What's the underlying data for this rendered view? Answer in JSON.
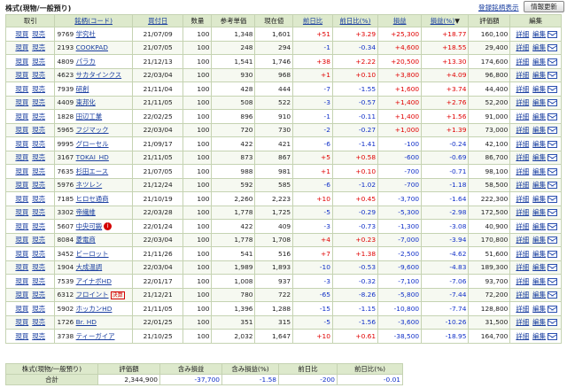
{
  "header": {
    "title": "株式(現物/一般預り)",
    "register_link": "登録銘柄表示",
    "refresh_button": "情報更新"
  },
  "columns": {
    "trade": "取引",
    "code": "銘柄(コード)",
    "buy_date": "買付日",
    "qty": "数量",
    "ref_price": "参考単価",
    "cur_price": "現在値",
    "day_change": "前日比",
    "day_change_pct": "前日比(%)",
    "pl": "損益",
    "pl_pct": "損益(%)",
    "sort_mark": "▼",
    "value": "評価額",
    "edit": "編集"
  },
  "actions": {
    "buy": "現買",
    "sell": "現売",
    "detail": "詳細",
    "edit": "編集"
  },
  "rows": [
    {
      "code": "9769",
      "name": "学究社",
      "date": "21/07/09",
      "qty": "100",
      "ref": "1,348",
      "cur": "1,601",
      "chg": "+51",
      "chgp": "+3.29",
      "pl": "+25,300",
      "plp": "+18.77",
      "val": "160,100"
    },
    {
      "code": "2193",
      "name": "COOKPAD",
      "date": "21/07/05",
      "qty": "100",
      "ref": "248",
      "cur": "294",
      "chg": "-1",
      "chgp": "-0.34",
      "pl": "+4,600",
      "plp": "+18.55",
      "val": "29,400"
    },
    {
      "code": "4809",
      "name": "パラカ",
      "date": "21/12/13",
      "qty": "100",
      "ref": "1,541",
      "cur": "1,746",
      "chg": "+38",
      "chgp": "+2.22",
      "pl": "+20,500",
      "plp": "+13.30",
      "val": "174,600"
    },
    {
      "code": "4623",
      "name": "サカタインクス",
      "date": "22/03/04",
      "qty": "100",
      "ref": "930",
      "cur": "968",
      "chg": "+1",
      "chgp": "+0.10",
      "pl": "+3,800",
      "plp": "+4.09",
      "val": "96,800"
    },
    {
      "code": "7939",
      "name": "研創",
      "date": "21/11/04",
      "qty": "100",
      "ref": "428",
      "cur": "444",
      "chg": "-7",
      "chgp": "-1.55",
      "pl": "+1,600",
      "plp": "+3.74",
      "val": "44,400"
    },
    {
      "code": "4409",
      "name": "東邦化",
      "date": "21/11/05",
      "qty": "100",
      "ref": "508",
      "cur": "522",
      "chg": "-3",
      "chgp": "-0.57",
      "pl": "+1,400",
      "plp": "+2.76",
      "val": "52,200"
    },
    {
      "code": "1828",
      "name": "田辺工業",
      "date": "22/02/25",
      "qty": "100",
      "ref": "896",
      "cur": "910",
      "chg": "-1",
      "chgp": "-0.11",
      "pl": "+1,400",
      "plp": "+1.56",
      "val": "91,000"
    },
    {
      "code": "5965",
      "name": "フジマック",
      "date": "22/03/04",
      "qty": "100",
      "ref": "720",
      "cur": "730",
      "chg": "-2",
      "chgp": "-0.27",
      "pl": "+1,000",
      "plp": "+1.39",
      "val": "73,000"
    },
    {
      "code": "9995",
      "name": "グローセル",
      "date": "21/09/17",
      "qty": "100",
      "ref": "422",
      "cur": "421",
      "chg": "-6",
      "chgp": "-1.41",
      "pl": "-100",
      "plp": "-0.24",
      "val": "42,100"
    },
    {
      "code": "3167",
      "name": "TOKAI_HD",
      "date": "21/11/05",
      "qty": "100",
      "ref": "873",
      "cur": "867",
      "chg": "+5",
      "chgp": "+0.58",
      "pl": "-600",
      "plp": "-0.69",
      "val": "86,700"
    },
    {
      "code": "7635",
      "name": "杉田エース",
      "date": "21/07/05",
      "qty": "100",
      "ref": "988",
      "cur": "981",
      "chg": "+1",
      "chgp": "+0.10",
      "pl": "-700",
      "plp": "-0.71",
      "val": "98,100"
    },
    {
      "code": "5976",
      "name": "ネツレン",
      "date": "21/12/24",
      "qty": "100",
      "ref": "592",
      "cur": "585",
      "chg": "-6",
      "chgp": "-1.02",
      "pl": "-700",
      "plp": "-1.18",
      "val": "58,500"
    },
    {
      "code": "7185",
      "name": "ヒロセ通商",
      "date": "21/10/19",
      "qty": "100",
      "ref": "2,260",
      "cur": "2,223",
      "chg": "+10",
      "chgp": "+0.45",
      "pl": "-3,700",
      "plp": "-1.64",
      "val": "222,300"
    },
    {
      "code": "3302",
      "name": "帝繊維",
      "date": "22/03/28",
      "qty": "100",
      "ref": "1,778",
      "cur": "1,725",
      "chg": "-5",
      "chgp": "-0.29",
      "pl": "-5,300",
      "plp": "-2.98",
      "val": "172,500"
    },
    {
      "code": "5607",
      "name": "中央可鍛",
      "date": "22/01/24",
      "qty": "100",
      "ref": "422",
      "cur": "409",
      "chg": "-3",
      "chgp": "-0.73",
      "pl": "-1,300",
      "plp": "-3.08",
      "val": "40,900",
      "badge": "info"
    },
    {
      "code": "8084",
      "name": "菱電商",
      "date": "22/03/04",
      "qty": "100",
      "ref": "1,778",
      "cur": "1,708",
      "chg": "+4",
      "chgp": "+0.23",
      "pl": "-7,000",
      "plp": "-3.94",
      "val": "170,800"
    },
    {
      "code": "3452",
      "name": "ビーロット",
      "date": "21/11/26",
      "qty": "100",
      "ref": "541",
      "cur": "516",
      "chg": "+7",
      "chgp": "+1.38",
      "pl": "-2,500",
      "plp": "-4.62",
      "val": "51,600"
    },
    {
      "code": "1904",
      "name": "大成温調",
      "date": "22/03/04",
      "qty": "100",
      "ref": "1,989",
      "cur": "1,893",
      "chg": "-10",
      "chgp": "-0.53",
      "pl": "-9,600",
      "plp": "-4.83",
      "val": "189,300"
    },
    {
      "code": "7539",
      "name": "アイナボHD",
      "date": "22/01/17",
      "qty": "100",
      "ref": "1,008",
      "cur": "937",
      "chg": "-3",
      "chgp": "-0.32",
      "pl": "-7,100",
      "plp": "-7.06",
      "val": "93,700"
    },
    {
      "code": "6312",
      "name": "フロイント",
      "date": "21/12/21",
      "qty": "100",
      "ref": "780",
      "cur": "722",
      "chg": "-65",
      "chgp": "-8.26",
      "pl": "-5,800",
      "plp": "-7.44",
      "val": "72,200",
      "badge": "ex",
      "badge_text": "決算"
    },
    {
      "code": "5902",
      "name": "ホッカンHD",
      "date": "21/11/05",
      "qty": "100",
      "ref": "1,396",
      "cur": "1,288",
      "chg": "-15",
      "chgp": "-1.15",
      "pl": "-10,800",
      "plp": "-7.74",
      "val": "128,800"
    },
    {
      "code": "1726",
      "name": "Br. HD",
      "date": "22/01/25",
      "qty": "100",
      "ref": "351",
      "cur": "315",
      "chg": "-5",
      "chgp": "-1.56",
      "pl": "-3,600",
      "plp": "-10.26",
      "val": "31,500"
    },
    {
      "code": "3738",
      "name": "ティーガイア",
      "date": "21/10/25",
      "qty": "100",
      "ref": "2,032",
      "cur": "1,647",
      "chg": "+10",
      "chgp": "+0.61",
      "pl": "-38,500",
      "plp": "-18.95",
      "val": "164,700"
    }
  ],
  "summary": {
    "label1": "株式(現物/一般預り)",
    "label2": "合計",
    "h_value": "評価額",
    "h_pl": "含み損益",
    "h_pl_pct": "含み損益(%)",
    "h_day": "前日比",
    "h_day_pct": "前日比(%)",
    "value": "2,344,900",
    "pl": "-37,700",
    "pl_pct": "-1.58",
    "day": "-200",
    "day_pct": "-0.01"
  },
  "colors": {
    "positive": "#e00000",
    "negative": "#1030c8",
    "header_bg": "#dde9cc",
    "link": "#1a3fa0"
  }
}
